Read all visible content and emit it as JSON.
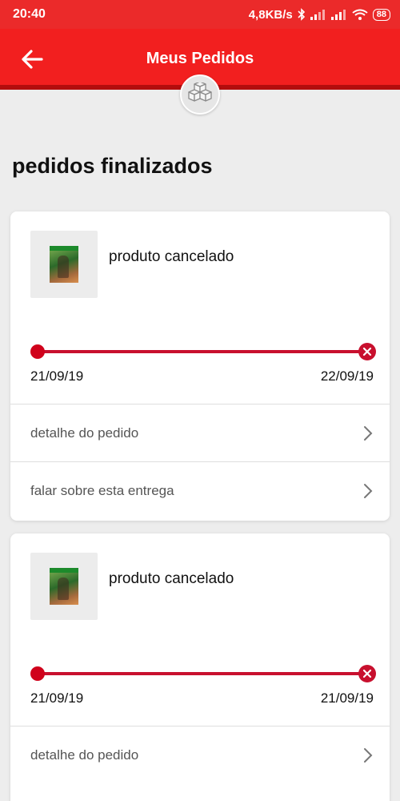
{
  "status_bar": {
    "time": "20:40",
    "speed": "4,8KB/s",
    "battery": "88"
  },
  "header": {
    "title": "Meus Pedidos"
  },
  "section_title": "pedidos finalizados",
  "orders": [
    {
      "status": "produto cancelado",
      "start_date": "21/09/19",
      "end_date": "22/09/19",
      "actions": [
        "detalhe do pedido",
        "falar sobre esta entrega"
      ]
    },
    {
      "status": "produto cancelado",
      "start_date": "21/09/19",
      "end_date": "21/09/19",
      "actions": [
        "detalhe do pedido"
      ]
    }
  ],
  "colors": {
    "primary_red": "#f21f1f",
    "dark_red": "#b30d0d",
    "track_red": "#c8102e"
  }
}
